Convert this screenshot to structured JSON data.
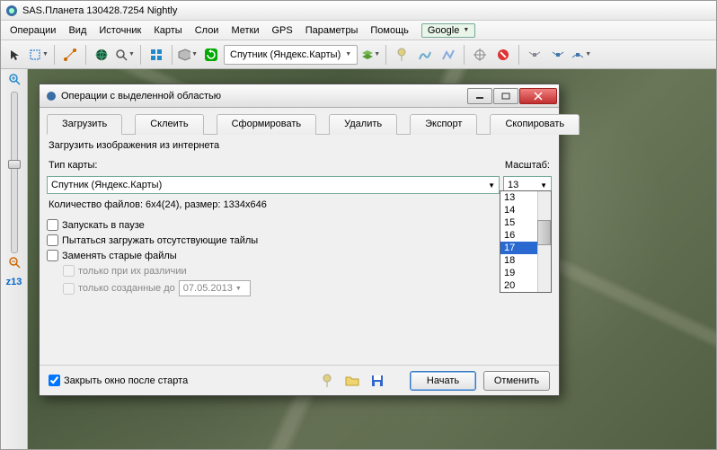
{
  "app": {
    "title": "SAS.Планета 130428.7254 Nightly"
  },
  "menu": {
    "items": [
      "Операции",
      "Вид",
      "Источник",
      "Карты",
      "Слои",
      "Метки",
      "GPS",
      "Параметры",
      "Помощь"
    ],
    "google": "Google"
  },
  "toolbar": {
    "layer_label": "Спутник (Яндекс.Карты)"
  },
  "left": {
    "zoom_label": "z13"
  },
  "dialog": {
    "title": "Операции с выделенной областью",
    "tabs": [
      "Загрузить",
      "Склеить",
      "Сформировать",
      "Удалить",
      "Экспорт",
      "Скопировать"
    ],
    "section": "Загрузить изображения из интернета",
    "map_type_label": "Тип карты:",
    "map_type_value": "Спутник (Яндекс.Карты)",
    "scale_label": "Масштаб:",
    "scale_value": "13",
    "scale_options": [
      "13",
      "14",
      "15",
      "16",
      "17",
      "18",
      "19",
      "20"
    ],
    "scale_selected": "17",
    "tiles_info": "Количество файлов: 6x4(24), размер: 1334x646",
    "chk_pause": "Запускать в паузе",
    "chk_missing": "Пытаться загружать отсутствующие тайлы",
    "chk_replace": "Заменять старые файлы",
    "chk_diff": "только при их различии",
    "chk_created": "только созданные до",
    "date": "07.05.2013",
    "chk_close": "Закрыть окно после старта",
    "start": "Начать",
    "cancel": "Отменить"
  }
}
